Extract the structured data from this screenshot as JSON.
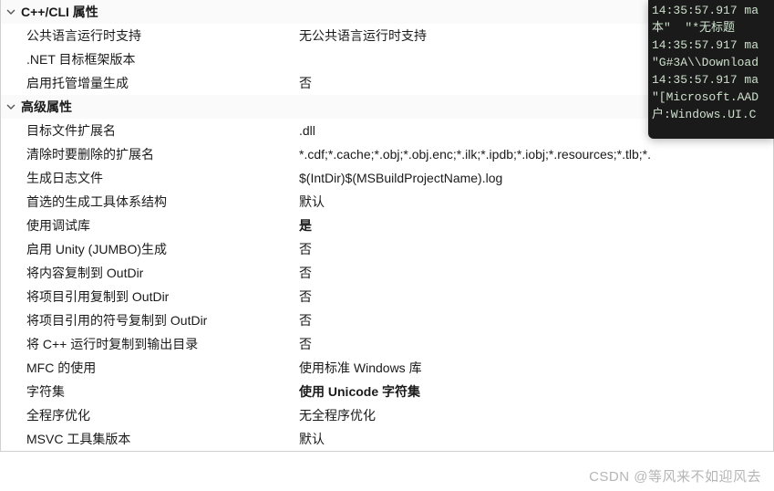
{
  "groups": [
    {
      "title": "C++/CLI 属性",
      "rows": [
        {
          "label": "公共语言运行时支持",
          "value": "无公共语言运行时支持",
          "bold": false
        },
        {
          "label": ".NET 目标框架版本",
          "value": "",
          "bold": false
        },
        {
          "label": "启用托管增量生成",
          "value": "否",
          "bold": false
        }
      ]
    },
    {
      "title": "高级属性",
      "rows": [
        {
          "label": "目标文件扩展名",
          "value": ".dll",
          "bold": false
        },
        {
          "label": "清除时要删除的扩展名",
          "value": "*.cdf;*.cache;*.obj;*.obj.enc;*.ilk;*.ipdb;*.iobj;*.resources;*.tlb;*.",
          "bold": false
        },
        {
          "label": "生成日志文件",
          "value": "$(IntDir)$(MSBuildProjectName).log",
          "bold": false
        },
        {
          "label": "首选的生成工具体系结构",
          "value": "默认",
          "bold": false
        },
        {
          "label": "使用调试库",
          "value": "是",
          "bold": true
        },
        {
          "label": "启用 Unity (JUMBO)生成",
          "value": "否",
          "bold": false
        },
        {
          "label": "将内容复制到 OutDir",
          "value": "否",
          "bold": false
        },
        {
          "label": "将项目引用复制到 OutDir",
          "value": "否",
          "bold": false
        },
        {
          "label": "将项目引用的符号复制到 OutDir",
          "value": "否",
          "bold": false
        },
        {
          "label": "将 C++ 运行时复制到输出目录",
          "value": "否",
          "bold": false
        },
        {
          "label": "MFC 的使用",
          "value": "使用标准 Windows 库",
          "bold": false
        },
        {
          "label": "字符集",
          "value": "使用 Unicode 字符集",
          "bold": true
        },
        {
          "label": "全程序优化",
          "value": "无全程序优化",
          "bold": false
        },
        {
          "label": "MSVC 工具集版本",
          "value": "默认",
          "bold": false
        }
      ]
    }
  ],
  "console": {
    "lines": [
      "14:35:57.917 ma",
      "本\"  \"*无标题",
      "14:35:57.917 ma",
      "\"G#3A\\\\Download",
      "14:35:57.917 ma",
      "\"[Microsoft.AAD",
      "户:Windows.UI.C"
    ]
  },
  "watermark": "CSDN @等风来不如迎风去"
}
